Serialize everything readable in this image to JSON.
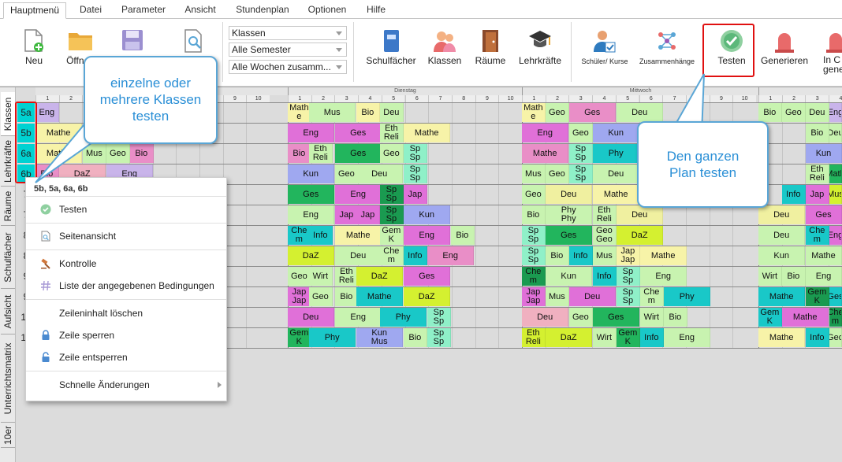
{
  "menu_tabs": [
    "Hauptmenü",
    "Datei",
    "Parameter",
    "Ansicht",
    "Stundenplan",
    "Optionen",
    "Hilfe"
  ],
  "ribbon": {
    "neu": "Neu",
    "oeffnen": "Öffnen",
    "dropdowns": [
      "Klassen",
      "Alle Semester",
      "Alle Wochen zusamm..."
    ],
    "schulfaecher": "Schulfächer",
    "klassen": "Klassen",
    "raeume": "Räume",
    "lehrkraefte": "Lehrkräfte",
    "schueler_kurse": "Schüler/ Kurse",
    "zusammenhaenge": "Zusammenhänge",
    "testen": "Testen",
    "generieren": "Generieren",
    "in_c": "In C",
    "gener": "gener"
  },
  "side_tabs": [
    "Klassen",
    "Lehrkräfte",
    "Räume",
    "Schulfächer",
    "Aufsicht",
    "Unterrichtsmatrix",
    "10er"
  ],
  "days": [
    "Dienstag",
    "Mittwoch"
  ],
  "period_numbers": [
    "1",
    "2",
    "3",
    "4",
    "5",
    "6",
    "7",
    "8",
    "9",
    "10"
  ],
  "row_labels": [
    "5a",
    "5b",
    "6a",
    "6b",
    "7",
    "7",
    "8",
    "8",
    "9",
    "9",
    "10",
    "10"
  ],
  "callouts": {
    "left": "einzelne oder mehrere Klassen testen",
    "right": "Den ganzen Plan testen"
  },
  "context_menu": {
    "header": "5b, 5a, 6a, 6b",
    "items": [
      "Testen",
      "Seitenansicht",
      "Kontrolle",
      "Liste der angegebenen Bedingungen",
      "Zeileninhalt löschen",
      "Zeile sperren",
      "Zeile entsperren",
      "Schnelle Änderungen"
    ]
  },
  "colors": {
    "accent": "#5aa6d6",
    "highlight": "#e01010",
    "selected_row": "#00d2d2"
  },
  "rows": [
    [
      [
        25,
        "Eng",
        "#c9b4ea",
        1
      ],
      [
        345,
        "Math|e",
        "#f7f3a8",
        1
      ],
      [
        372,
        "Mus",
        "#c8f3b0",
        2
      ],
      [
        432,
        "Bio",
        "#f7f3a8",
        1
      ],
      [
        462,
        "Deu",
        "#c8f3b0",
        1
      ],
      [
        642,
        "Math|e",
        "#f7f3a8",
        1
      ],
      [
        672,
        "Geo",
        "#c8f3b0",
        1
      ],
      [
        702,
        "Ges",
        "#e98ec7",
        2
      ],
      [
        762,
        "Deu",
        "#c8f3b0",
        2
      ],
      [
        942,
        "Bio",
        "#c8f3b0",
        1
      ],
      [
        972,
        "Geo",
        "#c8f3b0",
        1
      ],
      [
        1002,
        "Deu",
        "#c8f3b0",
        1
      ],
      [
        1032,
        "Eng",
        "#c9b4ea",
        1
      ]
    ],
    [
      [
        25,
        "Mathe",
        "#f7f3a8",
        2
      ],
      [
        345,
        "Eng",
        "#e070d8",
        2
      ],
      [
        405,
        "Ges",
        "#e070d8",
        2
      ],
      [
        462,
        "Eth|Reli",
        "#c8f3b0",
        1
      ],
      [
        492,
        "Mathe",
        "#f7f3a8",
        2
      ],
      [
        642,
        "Eng",
        "#e070d8",
        2
      ],
      [
        702,
        "Geo",
        "#c8f3b0",
        1
      ],
      [
        732,
        "Kun",
        "#9fa8f0",
        2
      ],
      [
        1002,
        "Bio",
        "#c8f3b0",
        1
      ],
      [
        1032,
        "Deu",
        "#c8f3b0",
        1
      ]
    ],
    [
      [
        25,
        "Mathe",
        "#f7f3a8",
        2
      ],
      [
        85,
        "Mus",
        "#c8f3b0",
        1
      ],
      [
        115,
        "Geo",
        "#c8f3b0",
        1
      ],
      [
        145,
        "Bio",
        "#e98ec7",
        1
      ],
      [
        345,
        "Bio",
        "#e98ec7",
        1
      ],
      [
        372,
        "Eth|Reli",
        "#c8f3b0",
        1
      ],
      [
        405,
        "Ges",
        "#22b55d",
        2
      ],
      [
        462,
        "Geo",
        "#c8f3b0",
        1
      ],
      [
        492,
        "Sp|Sp",
        "#8ff0c8",
        1
      ],
      [
        642,
        "Mathe",
        "#e98ec7",
        2
      ],
      [
        702,
        "Sp|Sp",
        "#8ff0c8",
        1
      ],
      [
        732,
        "Phy",
        "#19c8c8",
        2
      ],
      [
        1002,
        "Kun",
        "#9fa8f0",
        2
      ]
    ],
    [
      [
        25,
        "Bio",
        "#e98ec7",
        1
      ],
      [
        55,
        "DaZ",
        "#f0b0c0",
        2
      ],
      [
        115,
        "Eng",
        "#c9b4ea",
        2
      ],
      [
        345,
        "Kun",
        "#9fa8f0",
        2
      ],
      [
        405,
        "Geo",
        "#c8f3b0",
        1
      ],
      [
        432,
        "Deu",
        "#c8f3b0",
        2
      ],
      [
        492,
        "Sp|Sp",
        "#8ff0c8",
        1
      ],
      [
        642,
        "Mus",
        "#c8f3b0",
        1
      ],
      [
        672,
        "Geo",
        "#c8f3b0",
        1
      ],
      [
        702,
        "Sp|Sp",
        "#8ff0c8",
        1
      ],
      [
        732,
        "Deu",
        "#c8f3b0",
        2
      ],
      [
        1002,
        "Eth|Reli",
        "#c8f3b0",
        1
      ],
      [
        1032,
        "Math",
        "#22b55d",
        1
      ]
    ],
    [
      [
        345,
        "Ges",
        "#22b55d",
        2
      ],
      [
        405,
        "Eng",
        "#e070d8",
        2
      ],
      [
        462,
        "Sp|Sp",
        "#1a9a50",
        1
      ],
      [
        492,
        "Jap",
        "#e070d8",
        1
      ],
      [
        642,
        "Geo",
        "#c8f3b0",
        1
      ],
      [
        672,
        "Deu",
        "#f0f0a0",
        2
      ],
      [
        732,
        "Mathe",
        "#f7f3a8",
        2
      ],
      [
        792,
        "Bio",
        "#c8f3b0",
        1
      ],
      [
        972,
        "Info",
        "#19c8c8",
        1
      ],
      [
        1002,
        "Jap",
        "#e070d8",
        1
      ],
      [
        1032,
        "Mus",
        "#d4f030",
        1
      ]
    ],
    [
      [
        345,
        "Eng",
        "#c8f3b0",
        2
      ],
      [
        405,
        "Jap",
        "#e070d8",
        1
      ],
      [
        432,
        "Jap",
        "#e070d8",
        1
      ],
      [
        462,
        "Sp|Sp",
        "#1a9a50",
        1
      ],
      [
        492,
        "Kun",
        "#9fa8f0",
        2
      ],
      [
        642,
        "Bio",
        "#c8f3b0",
        1
      ],
      [
        672,
        "Phy|Phy",
        "#c8f3b0",
        2
      ],
      [
        732,
        "Eth|Reli",
        "#c8f3b0",
        1
      ],
      [
        762,
        "Deu",
        "#f0f0a0",
        2
      ],
      [
        942,
        "Deu",
        "#f0f0a0",
        2
      ],
      [
        1002,
        "Ges",
        "#e070d8",
        2
      ]
    ],
    [
      [
        345,
        "Che|m",
        "#19c8c8",
        1
      ],
      [
        372,
        "Info",
        "#19c8c8",
        1
      ],
      [
        405,
        "Mathe",
        "#f7f3a8",
        2
      ],
      [
        462,
        "Gem|K",
        "#c8f3b0",
        1
      ],
      [
        492,
        "Eng",
        "#e070d8",
        2
      ],
      [
        552,
        "Bio",
        "#c8f3b0",
        1
      ],
      [
        642,
        "Sp|Sp",
        "#8ff0c8",
        1
      ],
      [
        672,
        "Ges",
        "#22b55d",
        2
      ],
      [
        732,
        "Geo|Geo",
        "#c8f3b0",
        1
      ],
      [
        762,
        "DaZ",
        "#d4f030",
        2
      ],
      [
        942,
        "Deu",
        "#c8f3b0",
        2
      ],
      [
        1002,
        "Che|m",
        "#19c8c8",
        1
      ],
      [
        1032,
        "Eng",
        "#e070d8",
        1
      ]
    ],
    [
      [
        345,
        "DaZ",
        "#d4f030",
        2
      ],
      [
        405,
        "Deu",
        "#c8f3b0",
        2
      ],
      [
        462,
        "Che|m",
        "#c8f3b0",
        1
      ],
      [
        492,
        "Info",
        "#19c8c8",
        1
      ],
      [
        522,
        "Eng",
        "#e98ec7",
        2
      ],
      [
        642,
        "Sp|Sp",
        "#8ff0c8",
        1
      ],
      [
        672,
        "Bio",
        "#c8f3b0",
        1
      ],
      [
        702,
        "Info",
        "#19c8c8",
        1
      ],
      [
        732,
        "Mus",
        "#c8f3b0",
        1
      ],
      [
        762,
        "Jap|Jap",
        "#f7f3a8",
        1
      ],
      [
        792,
        "Mathe",
        "#f7f3a8",
        2
      ],
      [
        942,
        "Kun",
        "#c8f3b0",
        2
      ],
      [
        1002,
        "Mathe",
        "#c8f3b0",
        2
      ]
    ],
    [
      [
        345,
        "Geo",
        "#c8f3b0",
        1
      ],
      [
        372,
        "Wirt",
        "#c8f3b0",
        1
      ],
      [
        405,
        "Eth|Reli",
        "#c8f3b0",
        1
      ],
      [
        432,
        "DaZ",
        "#d4f030",
        2
      ],
      [
        492,
        "Ges",
        "#e070d8",
        2
      ],
      [
        642,
        "Che|m",
        "#1a9a50",
        1
      ],
      [
        672,
        "Kun",
        "#c8f3b0",
        2
      ],
      [
        732,
        "Info",
        "#19c8c8",
        1
      ],
      [
        762,
        "Sp|Sp",
        "#8ff0c8",
        1
      ],
      [
        792,
        "Eng",
        "#c8f3b0",
        2
      ],
      [
        942,
        "Wirt",
        "#c8f3b0",
        1
      ],
      [
        972,
        "Bio",
        "#c8f3b0",
        1
      ],
      [
        1002,
        "Eng",
        "#c8f3b0",
        2
      ]
    ],
    [
      [
        345,
        "Jap|Jap",
        "#e070d8",
        1
      ],
      [
        372,
        "Geo",
        "#c8f3b0",
        1
      ],
      [
        405,
        "Bio",
        "#c8f3b0",
        1
      ],
      [
        432,
        "Mathe",
        "#19c8c8",
        2
      ],
      [
        492,
        "DaZ",
        "#d4f030",
        2
      ],
      [
        642,
        "Jap|Jap",
        "#e070d8",
        1
      ],
      [
        672,
        "Mus",
        "#c8f3b0",
        1
      ],
      [
        702,
        "Deu",
        "#e070d8",
        2
      ],
      [
        762,
        "Sp|Sp",
        "#8ff0c8",
        1
      ],
      [
        792,
        "Che|m",
        "#c8f3b0",
        1
      ],
      [
        822,
        "Phy",
        "#19c8c8",
        2
      ],
      [
        942,
        "Mathe",
        "#19c8c8",
        2
      ],
      [
        1002,
        "Gem|K",
        "#1a9a50",
        1
      ],
      [
        1032,
        "Ges",
        "#19c8c8",
        1
      ]
    ],
    [
      [
        345,
        "Deu",
        "#e070d8",
        2
      ],
      [
        405,
        "Eng",
        "#c8f3b0",
        2
      ],
      [
        462,
        "Phy",
        "#19c8c8",
        2
      ],
      [
        522,
        "Sp|Sp",
        "#8ff0c8",
        1
      ],
      [
        642,
        "Deu",
        "#f0b0c0",
        2
      ],
      [
        702,
        "Geo",
        "#c8f3b0",
        1
      ],
      [
        732,
        "Ges",
        "#22b55d",
        2
      ],
      [
        792,
        "Wirt",
        "#c8f3b0",
        1
      ],
      [
        822,
        "Bio",
        "#c8f3b0",
        1
      ],
      [
        942,
        "Gem|K",
        "#19c8c8",
        1
      ],
      [
        972,
        "Mathe",
        "#e070d8",
        2
      ],
      [
        1032,
        "Che|m",
        "#1a9a50",
        1
      ]
    ],
    [
      [
        345,
        "Gem|K",
        "#22b55d",
        1
      ],
      [
        372,
        "Phy",
        "#19c8c8",
        2
      ],
      [
        432,
        "Kun|Mus",
        "#9fa8f0",
        2
      ],
      [
        492,
        "Bio",
        "#c8f3b0",
        1
      ],
      [
        522,
        "Sp|Sp",
        "#8ff0c8",
        1
      ],
      [
        642,
        "Eth|Reli",
        "#d4f030",
        1
      ],
      [
        672,
        "DaZ",
        "#d4f030",
        2
      ],
      [
        732,
        "Wirt",
        "#c8f3b0",
        1
      ],
      [
        762,
        "Gem|K",
        "#22b55d",
        1
      ],
      [
        792,
        "Info",
        "#19c8c8",
        1
      ],
      [
        822,
        "Eng",
        "#c8f3b0",
        2
      ],
      [
        942,
        "Mathe",
        "#f7f3a8",
        2
      ],
      [
        1002,
        "Info",
        "#19c8c8",
        1
      ],
      [
        1032,
        "Geo",
        "#c8f3b0",
        1
      ]
    ]
  ]
}
